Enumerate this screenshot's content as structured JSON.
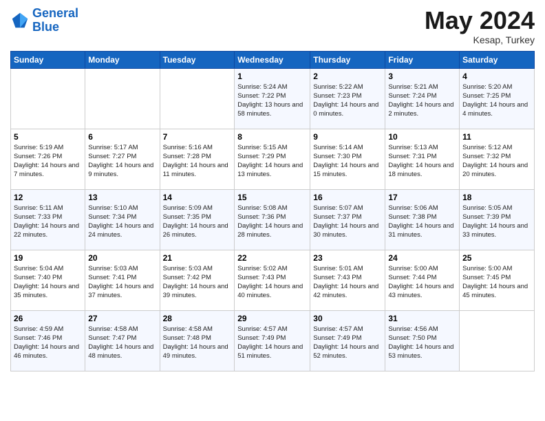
{
  "logo": {
    "name1": "General",
    "name2": "Blue"
  },
  "title": "May 2024",
  "location": "Kesap, Turkey",
  "headers": [
    "Sunday",
    "Monday",
    "Tuesday",
    "Wednesday",
    "Thursday",
    "Friday",
    "Saturday"
  ],
  "weeks": [
    [
      {
        "day": "",
        "sunrise": "",
        "sunset": "",
        "daylight": ""
      },
      {
        "day": "",
        "sunrise": "",
        "sunset": "",
        "daylight": ""
      },
      {
        "day": "",
        "sunrise": "",
        "sunset": "",
        "daylight": ""
      },
      {
        "day": "1",
        "sunrise": "Sunrise: 5:24 AM",
        "sunset": "Sunset: 7:22 PM",
        "daylight": "Daylight: 13 hours and 58 minutes."
      },
      {
        "day": "2",
        "sunrise": "Sunrise: 5:22 AM",
        "sunset": "Sunset: 7:23 PM",
        "daylight": "Daylight: 14 hours and 0 minutes."
      },
      {
        "day": "3",
        "sunrise": "Sunrise: 5:21 AM",
        "sunset": "Sunset: 7:24 PM",
        "daylight": "Daylight: 14 hours and 2 minutes."
      },
      {
        "day": "4",
        "sunrise": "Sunrise: 5:20 AM",
        "sunset": "Sunset: 7:25 PM",
        "daylight": "Daylight: 14 hours and 4 minutes."
      }
    ],
    [
      {
        "day": "5",
        "sunrise": "Sunrise: 5:19 AM",
        "sunset": "Sunset: 7:26 PM",
        "daylight": "Daylight: 14 hours and 7 minutes."
      },
      {
        "day": "6",
        "sunrise": "Sunrise: 5:17 AM",
        "sunset": "Sunset: 7:27 PM",
        "daylight": "Daylight: 14 hours and 9 minutes."
      },
      {
        "day": "7",
        "sunrise": "Sunrise: 5:16 AM",
        "sunset": "Sunset: 7:28 PM",
        "daylight": "Daylight: 14 hours and 11 minutes."
      },
      {
        "day": "8",
        "sunrise": "Sunrise: 5:15 AM",
        "sunset": "Sunset: 7:29 PM",
        "daylight": "Daylight: 14 hours and 13 minutes."
      },
      {
        "day": "9",
        "sunrise": "Sunrise: 5:14 AM",
        "sunset": "Sunset: 7:30 PM",
        "daylight": "Daylight: 14 hours and 15 minutes."
      },
      {
        "day": "10",
        "sunrise": "Sunrise: 5:13 AM",
        "sunset": "Sunset: 7:31 PM",
        "daylight": "Daylight: 14 hours and 18 minutes."
      },
      {
        "day": "11",
        "sunrise": "Sunrise: 5:12 AM",
        "sunset": "Sunset: 7:32 PM",
        "daylight": "Daylight: 14 hours and 20 minutes."
      }
    ],
    [
      {
        "day": "12",
        "sunrise": "Sunrise: 5:11 AM",
        "sunset": "Sunset: 7:33 PM",
        "daylight": "Daylight: 14 hours and 22 minutes."
      },
      {
        "day": "13",
        "sunrise": "Sunrise: 5:10 AM",
        "sunset": "Sunset: 7:34 PM",
        "daylight": "Daylight: 14 hours and 24 minutes."
      },
      {
        "day": "14",
        "sunrise": "Sunrise: 5:09 AM",
        "sunset": "Sunset: 7:35 PM",
        "daylight": "Daylight: 14 hours and 26 minutes."
      },
      {
        "day": "15",
        "sunrise": "Sunrise: 5:08 AM",
        "sunset": "Sunset: 7:36 PM",
        "daylight": "Daylight: 14 hours and 28 minutes."
      },
      {
        "day": "16",
        "sunrise": "Sunrise: 5:07 AM",
        "sunset": "Sunset: 7:37 PM",
        "daylight": "Daylight: 14 hours and 30 minutes."
      },
      {
        "day": "17",
        "sunrise": "Sunrise: 5:06 AM",
        "sunset": "Sunset: 7:38 PM",
        "daylight": "Daylight: 14 hours and 31 minutes."
      },
      {
        "day": "18",
        "sunrise": "Sunrise: 5:05 AM",
        "sunset": "Sunset: 7:39 PM",
        "daylight": "Daylight: 14 hours and 33 minutes."
      }
    ],
    [
      {
        "day": "19",
        "sunrise": "Sunrise: 5:04 AM",
        "sunset": "Sunset: 7:40 PM",
        "daylight": "Daylight: 14 hours and 35 minutes."
      },
      {
        "day": "20",
        "sunrise": "Sunrise: 5:03 AM",
        "sunset": "Sunset: 7:41 PM",
        "daylight": "Daylight: 14 hours and 37 minutes."
      },
      {
        "day": "21",
        "sunrise": "Sunrise: 5:03 AM",
        "sunset": "Sunset: 7:42 PM",
        "daylight": "Daylight: 14 hours and 39 minutes."
      },
      {
        "day": "22",
        "sunrise": "Sunrise: 5:02 AM",
        "sunset": "Sunset: 7:43 PM",
        "daylight": "Daylight: 14 hours and 40 minutes."
      },
      {
        "day": "23",
        "sunrise": "Sunrise: 5:01 AM",
        "sunset": "Sunset: 7:43 PM",
        "daylight": "Daylight: 14 hours and 42 minutes."
      },
      {
        "day": "24",
        "sunrise": "Sunrise: 5:00 AM",
        "sunset": "Sunset: 7:44 PM",
        "daylight": "Daylight: 14 hours and 43 minutes."
      },
      {
        "day": "25",
        "sunrise": "Sunrise: 5:00 AM",
        "sunset": "Sunset: 7:45 PM",
        "daylight": "Daylight: 14 hours and 45 minutes."
      }
    ],
    [
      {
        "day": "26",
        "sunrise": "Sunrise: 4:59 AM",
        "sunset": "Sunset: 7:46 PM",
        "daylight": "Daylight: 14 hours and 46 minutes."
      },
      {
        "day": "27",
        "sunrise": "Sunrise: 4:58 AM",
        "sunset": "Sunset: 7:47 PM",
        "daylight": "Daylight: 14 hours and 48 minutes."
      },
      {
        "day": "28",
        "sunrise": "Sunrise: 4:58 AM",
        "sunset": "Sunset: 7:48 PM",
        "daylight": "Daylight: 14 hours and 49 minutes."
      },
      {
        "day": "29",
        "sunrise": "Sunrise: 4:57 AM",
        "sunset": "Sunset: 7:49 PM",
        "daylight": "Daylight: 14 hours and 51 minutes."
      },
      {
        "day": "30",
        "sunrise": "Sunrise: 4:57 AM",
        "sunset": "Sunset: 7:49 PM",
        "daylight": "Daylight: 14 hours and 52 minutes."
      },
      {
        "day": "31",
        "sunrise": "Sunrise: 4:56 AM",
        "sunset": "Sunset: 7:50 PM",
        "daylight": "Daylight: 14 hours and 53 minutes."
      },
      {
        "day": "",
        "sunrise": "",
        "sunset": "",
        "daylight": ""
      }
    ]
  ]
}
